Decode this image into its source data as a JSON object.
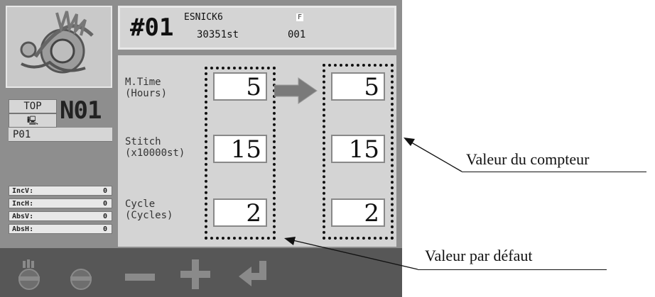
{
  "header": {
    "number": "#01",
    "design_name": "ESNICK6",
    "stitch_count": "30351st",
    "flag": "F",
    "code": "001"
  },
  "left_panel": {
    "top_label": "TOP",
    "needle": "N01",
    "program": "P01",
    "counters": [
      {
        "label": "IncV:",
        "value": "0"
      },
      {
        "label": "IncH:",
        "value": "0"
      },
      {
        "label": "AbsV:",
        "value": "0"
      },
      {
        "label": "AbsH:",
        "value": "0"
      }
    ]
  },
  "rows": [
    {
      "label": "M.Time\n(Hours)",
      "default_value": "5",
      "counter_value": "5"
    },
    {
      "label": "Stitch\n(x10000st)",
      "default_value": "15",
      "counter_value": "15"
    },
    {
      "label": "Cycle\n(Cycles)",
      "default_value": "2",
      "counter_value": "2"
    }
  ],
  "annotations": {
    "counter_value": "Valeur du compteur",
    "default_value": "Valeur par défaut"
  },
  "icons": [
    "logo-emblem-icon",
    "monitor-icon",
    "right-arrow-icon",
    "head-up-icon",
    "head-icon",
    "minus-icon",
    "plus-icon",
    "enter-icon"
  ],
  "colors": {
    "screen_bg": "#8e8e8e",
    "panel_bg": "#d4d4d4",
    "toolbar_bg": "#575757",
    "arrow": "#7a7a7a"
  }
}
